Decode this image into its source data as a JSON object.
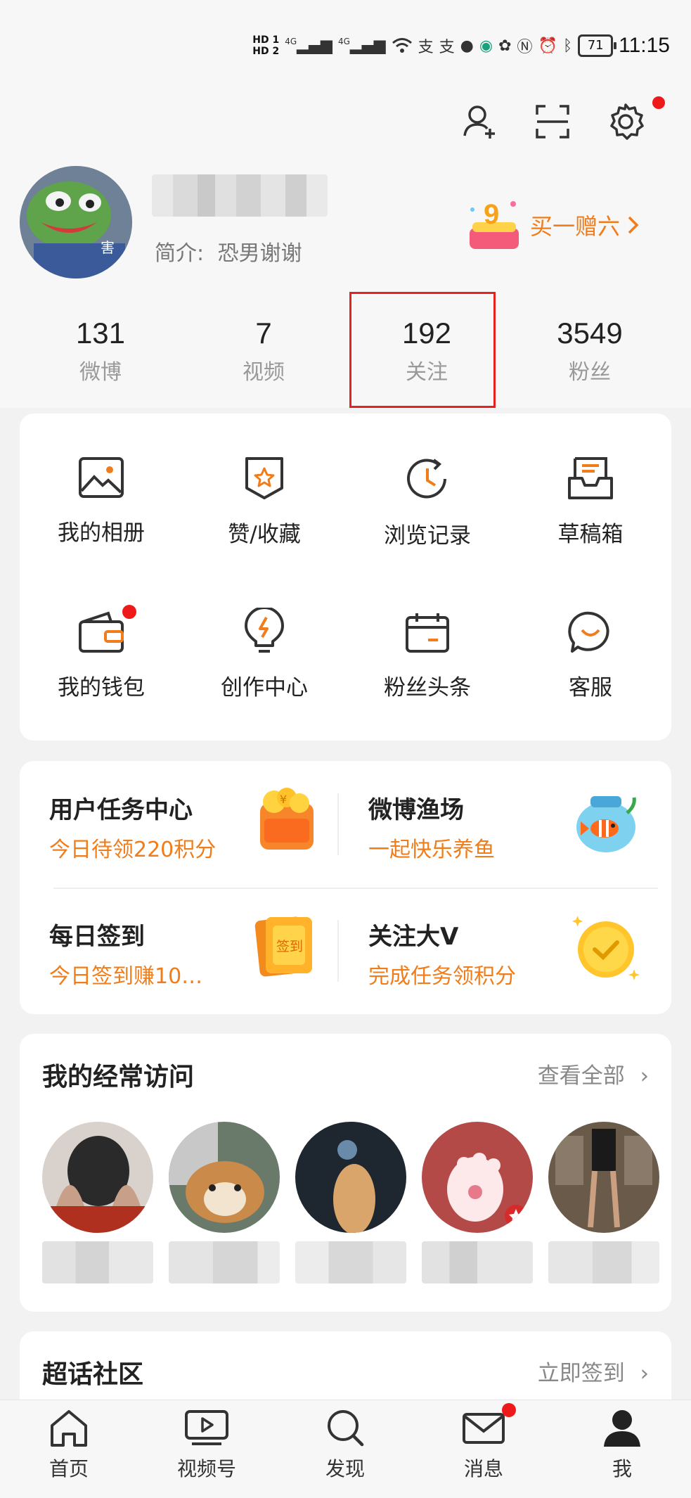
{
  "status_bar": {
    "hd1": "HD 1",
    "hd2": "HD 2",
    "network1": "4G",
    "network2": "4G",
    "battery": "71",
    "time": "11:15"
  },
  "header_icons": [
    "add-friend-icon",
    "scan-icon",
    "settings-icon"
  ],
  "profile": {
    "avatar_text": "害",
    "bio_label": "简介:",
    "bio_value": "恐男谢谢",
    "promo_label": "买一赠六",
    "promo_badge": "9"
  },
  "stats": [
    {
      "num": "131",
      "label": "微博"
    },
    {
      "num": "7",
      "label": "视频"
    },
    {
      "num": "192",
      "label": "关注"
    },
    {
      "num": "3549",
      "label": "粉丝"
    }
  ],
  "menu": [
    {
      "label": "我的相册",
      "icon": "photo-icon"
    },
    {
      "label": "赞/收藏",
      "icon": "bookmark-icon"
    },
    {
      "label": "浏览记录",
      "icon": "history-icon"
    },
    {
      "label": "草稿箱",
      "icon": "drafts-icon"
    },
    {
      "label": "我的钱包",
      "icon": "wallet-icon"
    },
    {
      "label": "创作中心",
      "icon": "lightbulb-icon"
    },
    {
      "label": "粉丝头条",
      "icon": "calendar-icon"
    },
    {
      "label": "客服",
      "icon": "chat-icon"
    }
  ],
  "tasks": [
    {
      "title": "用户任务中心",
      "sub": "今日待领220积分",
      "icon_text": "¥"
    },
    {
      "title": "微博渔场",
      "sub": "一起快乐养鱼"
    },
    {
      "title": "每日签到",
      "sub": "今日签到赚10…",
      "icon_text": "签到"
    },
    {
      "title": "关注大V",
      "sub": "完成任务领积分"
    }
  ],
  "frequent": {
    "title": "我的经常访问",
    "link": "查看全部"
  },
  "supertopic": {
    "title": "超话社区",
    "link": "立即签到"
  },
  "nav": [
    {
      "label": "首页",
      "icon": "home-icon"
    },
    {
      "label": "视频号",
      "icon": "video-icon"
    },
    {
      "label": "发现",
      "icon": "search-icon"
    },
    {
      "label": "消息",
      "icon": "mail-icon"
    },
    {
      "label": "我",
      "icon": "profile-icon"
    }
  ],
  "colors": {
    "accent": "#f07d1a",
    "badge_red": "#ee1a1a",
    "highlight_box": "#e52222"
  }
}
